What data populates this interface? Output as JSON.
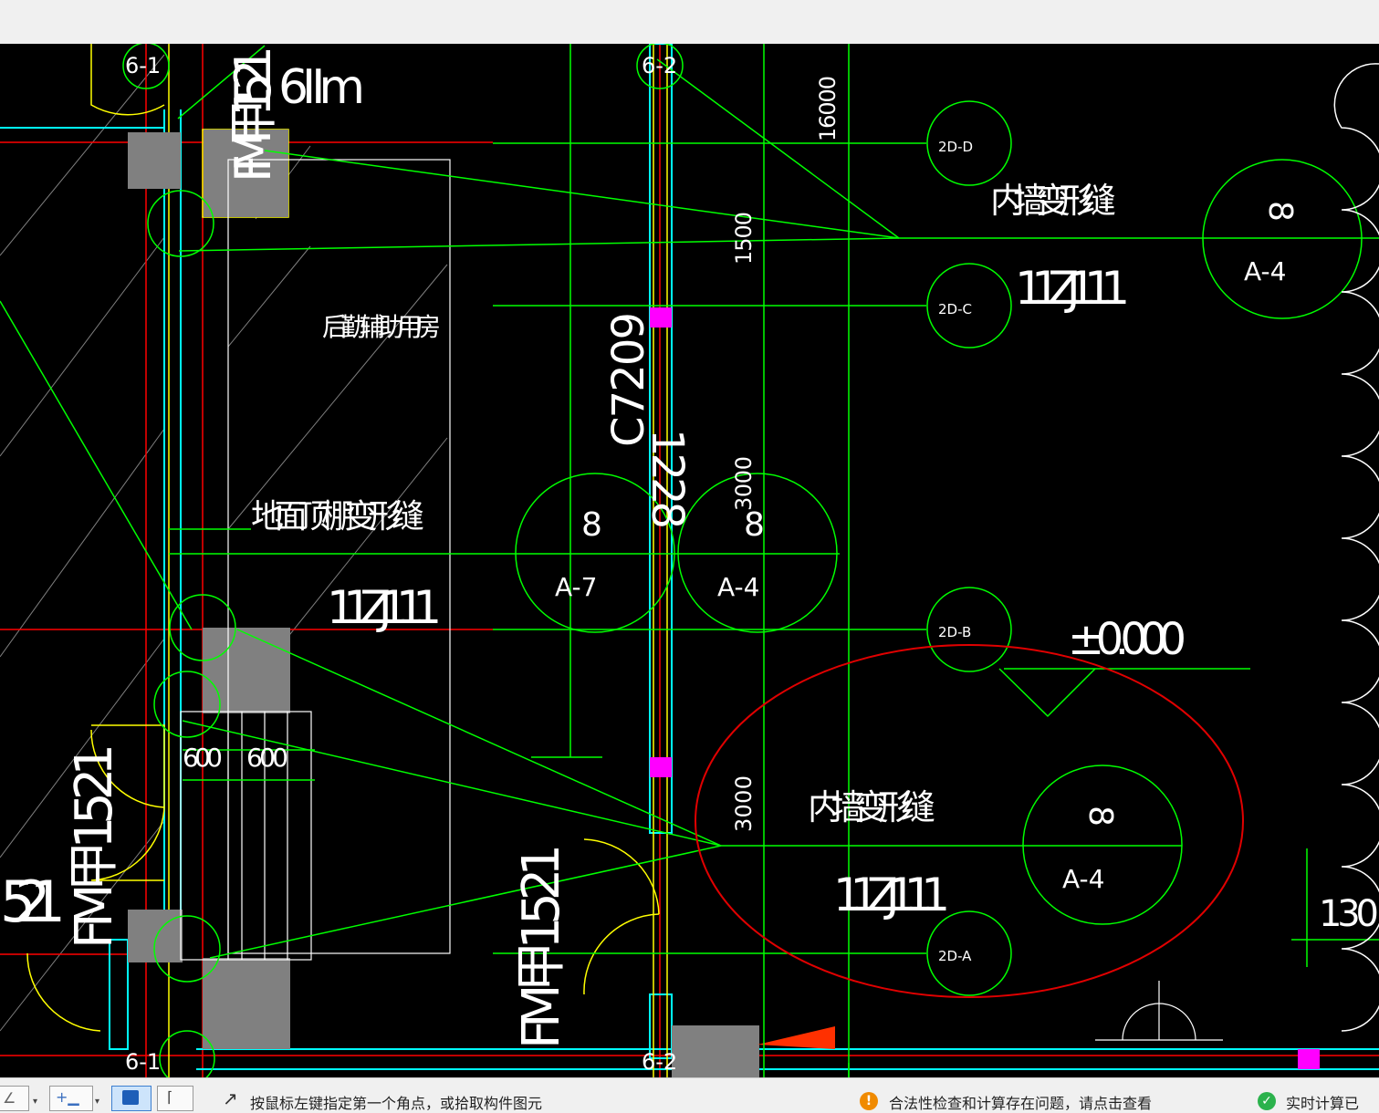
{
  "colors": {
    "canvas_bg": "#000000",
    "cad_green": "#00ff00",
    "cad_cyan": "#00ffff",
    "cad_yellow": "#ffff00",
    "cad_red": "#ff0000",
    "cad_white": "#ffffff",
    "cad_gray": "#808080",
    "cad_magenta": "#ff00ff",
    "markup_red": "#e00000",
    "warning_orange": "#f08a00",
    "ok_green": "#2bb24c"
  },
  "drawing": {
    "room_name": "后勤辅助用房",
    "joint_ground_ceiling": "地面顶棚变形缝",
    "joint_inner_wall_top": "内墙变形缝",
    "joint_inner_wall_bottom": "内墙变形缝",
    "atlas_top": "11ZJ111",
    "atlas_mid": "11ZJ111",
    "atlas_bottom": "11ZJ111",
    "elevation": "±0.000",
    "door_fm_top": "FM甲1521",
    "door_fm_left": "FM甲1521",
    "door_fm_left_partial": "521",
    "door_fm_bottom": "FM甲1521",
    "window_c": "C7209",
    "window_c_overlap": "1228",
    "section_62m": "6Ⅱm",
    "axis_6_1_top": "6-1",
    "axis_6_2_top": "6-2",
    "axis_6_1_bottom": "6-1",
    "axis_6_2_bottom": "6-2",
    "dim_16000": "16000",
    "dim_1500": "1500",
    "dim_3000_mid": "3000",
    "dim_3000_low": "3000",
    "dim_600_a": "600",
    "dim_600_b": "600",
    "dim_130": "130",
    "grid_2d_d": "2D-D",
    "grid_2d_c": "2D-C",
    "grid_2d_b": "2D-B",
    "grid_2d_a": "2D-A",
    "detail_a4_top_num": "8",
    "detail_a4_top_ref": "A-4",
    "detail_a7_num": "8",
    "detail_a7_ref": "A-7",
    "detail_a4_mid_num": "8",
    "detail_a4_mid_ref": "A-4",
    "detail_a4_low_num": "8",
    "detail_a4_low_ref": "A-4"
  },
  "toolbar_icons": [
    "line-tool-icon",
    "add-point-icon",
    "select-icon",
    "polyline-icon"
  ],
  "status": {
    "prompt": "按鼠标左键指定第一个角点，或拾取构件图元",
    "warning_badge": "!",
    "warning": "合法性检查和计算存在问题，请点击查看",
    "ok_badge": "✓",
    "realtime": "实时计算已"
  }
}
